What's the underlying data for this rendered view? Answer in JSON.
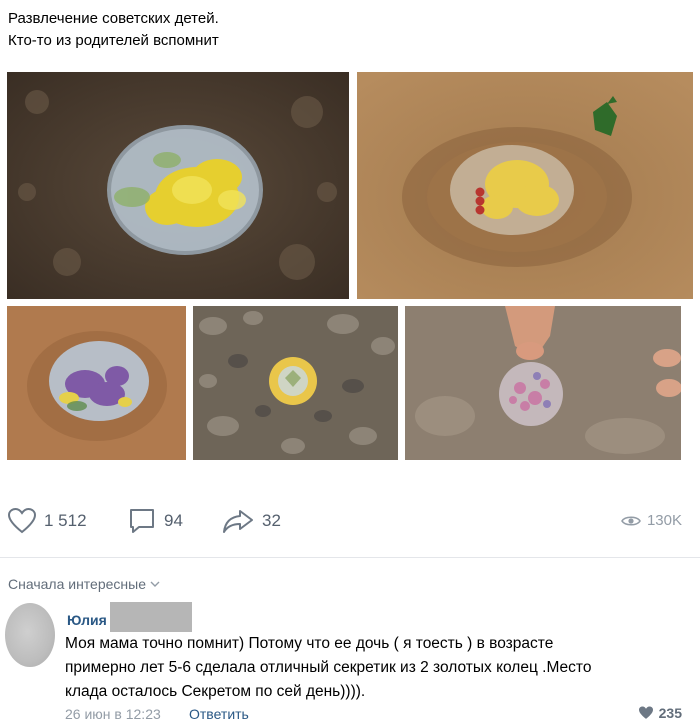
{
  "post": {
    "text_line1": "Развлечение советских детей.",
    "text_line2": "Кто-то из родителей вспомнит"
  },
  "photos": [
    {
      "name": "photo-secret-yellow-flower"
    },
    {
      "name": "photo-secret-yellow-leaves"
    },
    {
      "name": "photo-secret-purple-flowers"
    },
    {
      "name": "photo-secret-yellow-round"
    },
    {
      "name": "photo-secret-pink-petals"
    }
  ],
  "actions": {
    "likes": "1 512",
    "comments": "94",
    "shares": "32",
    "views": "130K"
  },
  "comments_section": {
    "sort_label": "Сначала интересные"
  },
  "comment": {
    "author": "Юлия",
    "text_line1": "Моя мама точно помнит) Потому что ее дочь ( я тоесть ) в возрасте",
    "text_line2": "примерно лет 5-6 сделала отличный секретик из 2 золотых колец .Место",
    "text_line3": "клада осталось Секретом по сей день)))).",
    "date": "26 июн в 12:23",
    "reply_label": "Ответить",
    "likes": "235"
  },
  "colors": {
    "link": "#2a5885",
    "icon": "#6d7885",
    "muted": "#939ca6"
  }
}
